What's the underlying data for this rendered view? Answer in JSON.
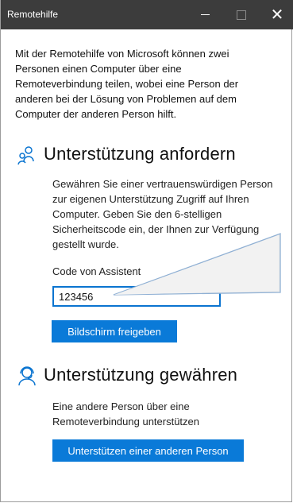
{
  "window": {
    "title": "Remotehilfe"
  },
  "intro_text": "Mit der Remotehilfe von Microsoft können zwei Personen einen Computer über eine Remoteverbindung teilen, wobei eine Person der anderen bei der Lösung von Problemen auf dem Computer der anderen Person hilft.",
  "get_help": {
    "heading": "Unterstützung anfordern",
    "description": "Gewähren Sie einer vertrauenswürdigen Person zur eigenen Unterstützung Zugriff auf Ihren Computer. Geben Sie den 6-stelligen Sicherheitscode ein, der Ihnen zur Verfügung gestellt wurde.",
    "code_label": "Code von Assistent",
    "code_value": "123456",
    "share_button": "Bildschirm freigeben",
    "icon": "people-icon"
  },
  "give_help": {
    "heading": "Unterstützung gewähren",
    "description": "Eine andere Person über eine Remoteverbindung unterstützen",
    "help_button": "Unterstützen einer anderen Person",
    "icon": "agent-icon"
  },
  "colors": {
    "accent": "#0a7ad8",
    "titlebar": "#3c3c3c"
  }
}
